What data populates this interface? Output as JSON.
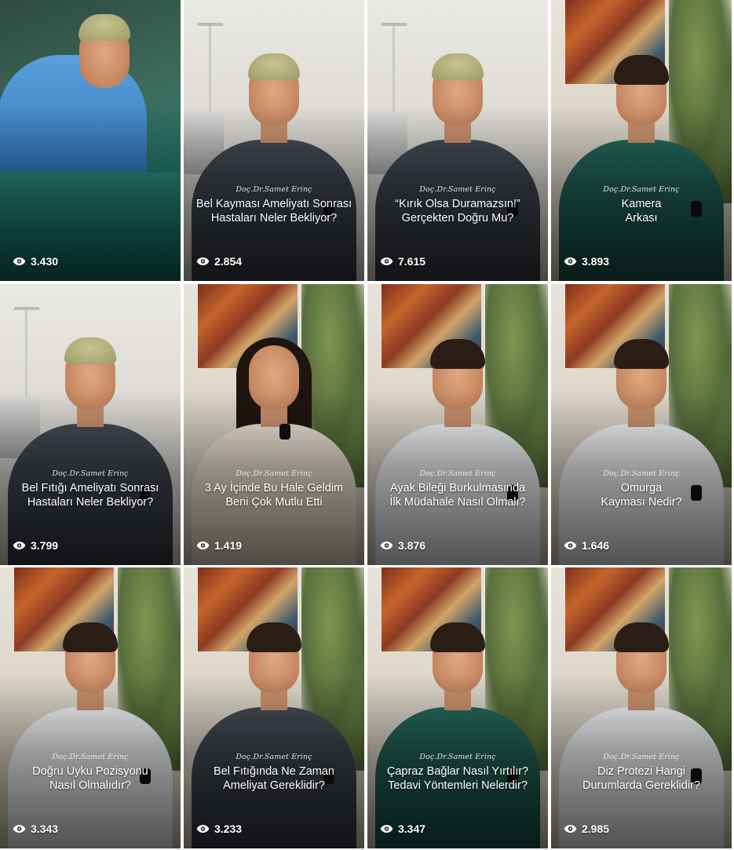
{
  "colors": {
    "text": "#ffffff",
    "scrubs_blue": "#4a90d0",
    "scrubs_green": "#1f5f52",
    "dark_shirt": "#3a3f47",
    "white_coat": "#e9ecef"
  },
  "grid": {
    "tiles": [
      {
        "signature": "",
        "title": "",
        "views": "3.430",
        "scene": "surgery",
        "outfit": "scrubs-blue",
        "headwear": "cap"
      },
      {
        "signature": "Doç.Dr.Samet Erinç",
        "title": "Bel Kayması Ameliyatı Sonrası\nHastaları Neler Bekliyor?",
        "views": "2.854",
        "scene": "clinic",
        "outfit": "dark",
        "headwear": "cap"
      },
      {
        "signature": "Doç.Dr.Samet Erinç",
        "title": "“Kırık Olsa Duramazsın!”\nGerçekten Doğru Mu?",
        "views": "7.615",
        "scene": "clinic",
        "outfit": "dark",
        "headwear": "cap"
      },
      {
        "signature": "Doç.Dr.Samet Erinç",
        "title": "Kamera\nArkası",
        "views": "3.893",
        "scene": "office",
        "outfit": "scrubs-green",
        "headwear": "hair"
      },
      {
        "signature": "Doç.Dr.Samet Erinç",
        "title": "Bel Fıtığı Ameliyatı Sonrası\nHastaları Neler Bekliyor?",
        "views": "3.799",
        "scene": "clinic",
        "outfit": "dark",
        "headwear": "cap"
      },
      {
        "signature": "Doç.Dr.Samet Erinç",
        "title": "3 Ay İçinde Bu Hale Geldim\nBeni Çok Mutlu Etti",
        "views": "1.419",
        "scene": "office",
        "outfit": "cream",
        "headwear": "longhair"
      },
      {
        "signature": "Doç.Dr.Samet Erinç",
        "title": "Ayak Bileği Burkulmasında\nİlk Müdahale Nasıl Olmalı?",
        "views": "3.876",
        "scene": "office",
        "outfit": "coat",
        "headwear": "hair"
      },
      {
        "signature": "Doç.Dr.Samet Erinç",
        "title": "Omurga\nKayması Nedir?",
        "views": "1.646",
        "scene": "office",
        "outfit": "coat",
        "headwear": "hair"
      },
      {
        "signature": "Doç.Dr.Samet Erinç",
        "title": "Doğru Uyku Pozisyonu\nNasıl Olmalıdır?",
        "views": "3.343",
        "scene": "office",
        "outfit": "coat",
        "headwear": "hair"
      },
      {
        "signature": "Doç.Dr.Samet Erinç",
        "title": "Bel Fıtığında Ne Zaman\nAmeliyat Gereklidir?",
        "views": "3.233",
        "scene": "office",
        "outfit": "dark",
        "headwear": "hair"
      },
      {
        "signature": "Doç.Dr.Samet Erinç",
        "title": "Çapraz Bağlar Nasıl Yırtılır?\nTedavi Yöntemleri Nelerdir?",
        "views": "3.347",
        "scene": "office",
        "outfit": "scrubs-green",
        "headwear": "hair"
      },
      {
        "signature": "Doç.Dr.Samet Erinç",
        "title": "Diz Protezi Hangi\nDurumlarda Gereklidir?",
        "views": "2.985",
        "scene": "office",
        "outfit": "coat",
        "headwear": "hair"
      }
    ]
  }
}
